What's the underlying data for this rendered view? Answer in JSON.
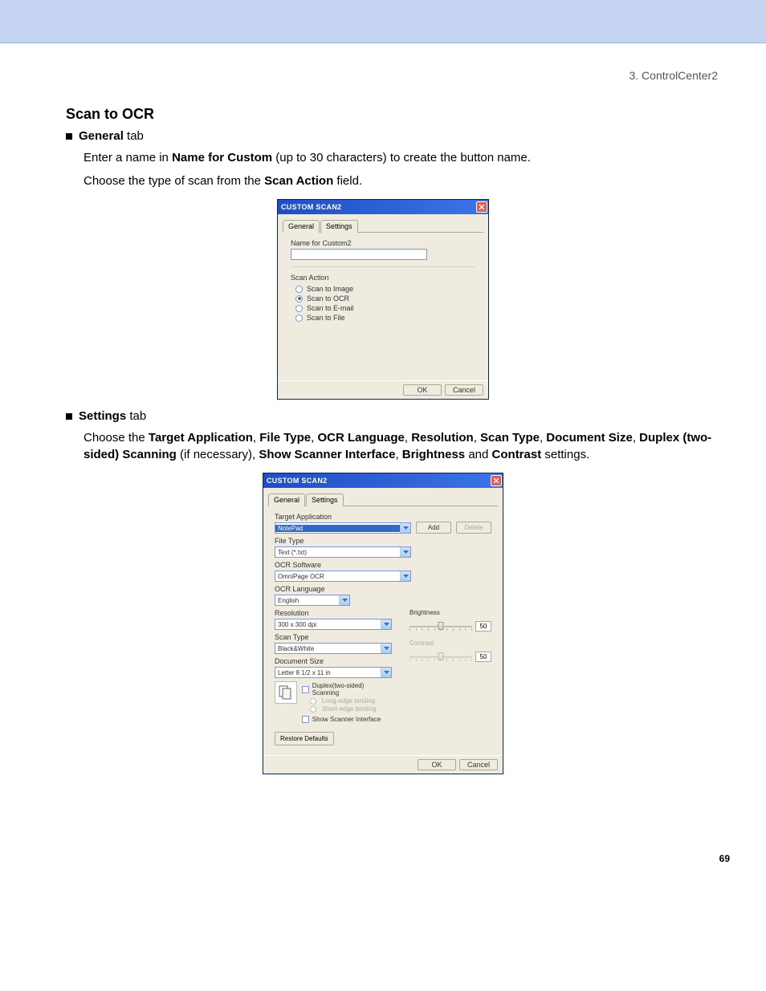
{
  "breadcrumb": "3. ControlCenter2",
  "section_title": "Scan to OCR",
  "general_tab_label": "General",
  "general_tab_suffix": " tab",
  "para_general_1_pre": "Enter a name in ",
  "para_general_1_bold": "Name for Custom",
  "para_general_1_post": " (up to 30 characters) to create the button name.",
  "para_general_2_pre": "Choose the type of scan from the ",
  "para_general_2_bold": "Scan Action",
  "para_general_2_post": " field.",
  "settings_tab_label": "Settings",
  "settings_tab_suffix": " tab",
  "para_settings_pre": "Choose the ",
  "para_settings_b1": "Target Application",
  "para_settings_b2": "File Type",
  "para_settings_b3": "OCR Language",
  "para_settings_b4": "Resolution",
  "para_settings_b5": "Scan Type",
  "para_settings_b6": "Document Size",
  "para_settings_b7": "Duplex (two-sided) Scanning",
  "para_settings_mid1": " (if necessary), ",
  "para_settings_b8": "Show Scanner Interface",
  "para_settings_b9": "Brightness",
  "para_settings_and": " and ",
  "para_settings_b10": "Contrast",
  "para_settings_post": " settings.",
  "page_number": "69",
  "dialog1": {
    "title": "CUSTOM SCAN2",
    "tab_general": "General",
    "tab_settings": "Settings",
    "name_label": "Name for Custom2",
    "scan_action_label": "Scan Action",
    "radio_image": "Scan to Image",
    "radio_ocr": "Scan to OCR",
    "radio_email": "Scan to E-mail",
    "radio_file": "Scan to File",
    "ok": "OK",
    "cancel": "Cancel"
  },
  "dialog2": {
    "title": "CUSTOM SCAN2",
    "tab_general": "General",
    "tab_settings": "Settings",
    "target_app_label": "Target Application",
    "target_app_value": "NotePad",
    "add": "Add",
    "delete": "Delete",
    "file_type_label": "File Type",
    "file_type_value": "Text (*.txt)",
    "ocr_software_label": "OCR Software",
    "ocr_software_value": "OmniPage OCR",
    "ocr_language_label": "OCR Language",
    "ocr_language_value": "English",
    "resolution_label": "Resolution",
    "resolution_value": "300 x 300 dpi",
    "scan_type_label": "Scan Type",
    "scan_type_value": "Black&White",
    "doc_size_label": "Document Size",
    "doc_size_value": "Letter 8 1/2 x 11 in",
    "brightness_label": "Brightness",
    "brightness_value": "50",
    "contrast_label": "Contrast",
    "contrast_value": "50",
    "duplex_label": "Duplex(two-sided) Scanning",
    "long_edge": "Long-edge binding",
    "short_edge": "Short-edge binding",
    "show_scanner": "Show Scanner Interface",
    "restore": "Restore Defaults",
    "ok": "OK",
    "cancel": "Cancel"
  }
}
